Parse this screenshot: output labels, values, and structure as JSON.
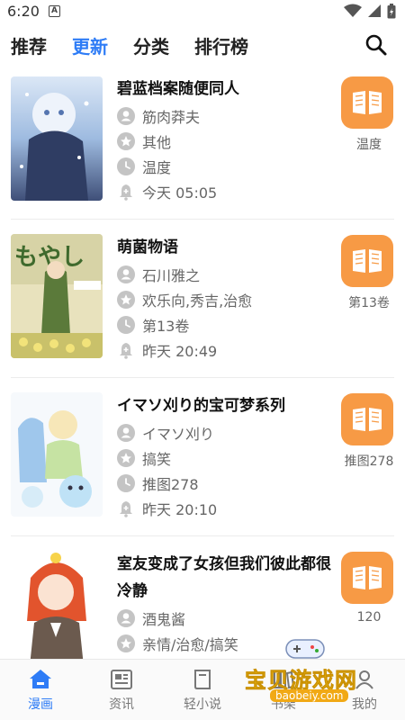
{
  "status_bar": {
    "time": "6:20",
    "app_icon": "A"
  },
  "top_tabs": [
    {
      "label": "推荐",
      "active": false
    },
    {
      "label": "更新",
      "active": true
    },
    {
      "label": "分类",
      "active": false
    },
    {
      "label": "排行榜",
      "active": false
    }
  ],
  "search_icon": "search-icon",
  "items": [
    {
      "title": "碧蓝档案随便同人",
      "author": "筋肉莽夫",
      "tags": "其他",
      "chapter": "温度",
      "time": "今天 05:05",
      "read_label": "温度"
    },
    {
      "title": "萌菌物语",
      "author": "石川雅之",
      "tags": "欢乐向,秀吉,治愈",
      "chapter": "第13卷",
      "time": "昨天 20:49",
      "read_label": "第13卷"
    },
    {
      "title": "イマソ刈り的宝可梦系列",
      "author": "イマソ刈り",
      "tags": "搞笑",
      "chapter": "推图278",
      "time": "昨天 20:10",
      "read_label": "推图278"
    },
    {
      "title": "室友变成了女孩但我们彼此都很冷静",
      "author": "酒鬼酱",
      "tags": "亲情/治愈/搞笑",
      "chapter": "",
      "time": "",
      "read_label": "120"
    }
  ],
  "bottom_nav": [
    {
      "label": "漫画",
      "icon": "home-icon",
      "active": true
    },
    {
      "label": "资讯",
      "icon": "news-icon",
      "active": false
    },
    {
      "label": "轻小说",
      "icon": "book-icon",
      "active": false
    },
    {
      "label": "书架",
      "icon": "bookshelf-icon",
      "active": false
    },
    {
      "label": "我的",
      "icon": "profile-icon",
      "active": false
    }
  ],
  "watermark": {
    "text": "宝贝游戏网",
    "url": "baobeiy.com"
  },
  "colors": {
    "accent": "#2e7cf6",
    "read_button": "#f79a45",
    "meta_icon": "#c4c4c4"
  }
}
